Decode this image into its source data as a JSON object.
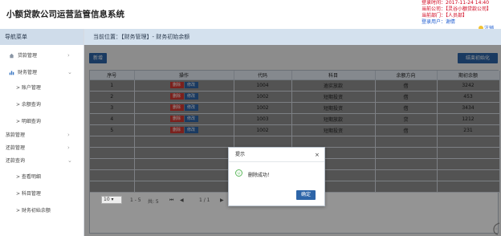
{
  "header": {
    "app_title": "小额贷款公司运营监管信息系统",
    "login_time": "登录时间：2017-11-24 14:40",
    "company": "当前公司：【灵谷小额贷款公司】",
    "department": "当前部门：【人员部】",
    "user": "登录用户：谢倩",
    "logout": "注销"
  },
  "sidebar": {
    "title": "导航菜单",
    "items": [
      {
        "label": "贷款管理"
      },
      {
        "label": "财务管理"
      },
      {
        "label": "> 账户管理"
      },
      {
        "label": "> 余额查询"
      },
      {
        "label": "> 明细查询"
      },
      {
        "label": "放款管理"
      },
      {
        "label": "还款管理"
      },
      {
        "label": "还款查询"
      },
      {
        "label": "> 查看明细"
      },
      {
        "label": "> 科目管理"
      },
      {
        "label": "> 财务初始余额"
      }
    ]
  },
  "breadcrumb": "当前位置：【财务管理】- 财务初始余额",
  "toolbar": {
    "add": "新增",
    "init": "结束初始化"
  },
  "table": {
    "columns": [
      "序号",
      "操作",
      "代码",
      "科目",
      "余额方向",
      "期初余额"
    ],
    "delete_label": "删除",
    "edit_label": "修改",
    "rows": [
      {
        "no": "1",
        "code": "1004",
        "subject": "逾实放款",
        "direction": "借",
        "balance": "3242"
      },
      {
        "no": "2",
        "code": "1002",
        "subject": "短期投资",
        "direction": "借",
        "balance": "453"
      },
      {
        "no": "3",
        "code": "1002",
        "subject": "短期投资",
        "direction": "借",
        "balance": "3434"
      },
      {
        "no": "4",
        "code": "1003",
        "subject": "短期放款",
        "direction": "贷",
        "balance": "1212"
      },
      {
        "no": "5",
        "code": "1002",
        "subject": "短期投资",
        "direction": "借",
        "balance": "231"
      }
    ]
  },
  "pager": {
    "page_size": "10",
    "range": "1 - 5",
    "total": "共: 5",
    "page": "1 / 1"
  },
  "dialog": {
    "title": "提示",
    "message": "删除成功！",
    "ok": "确定",
    "close": "×"
  },
  "colors": {
    "primary": "#2d65a8",
    "danger": "#d43a32",
    "alert_red": "#d0021b",
    "success": "#5cb85c"
  }
}
